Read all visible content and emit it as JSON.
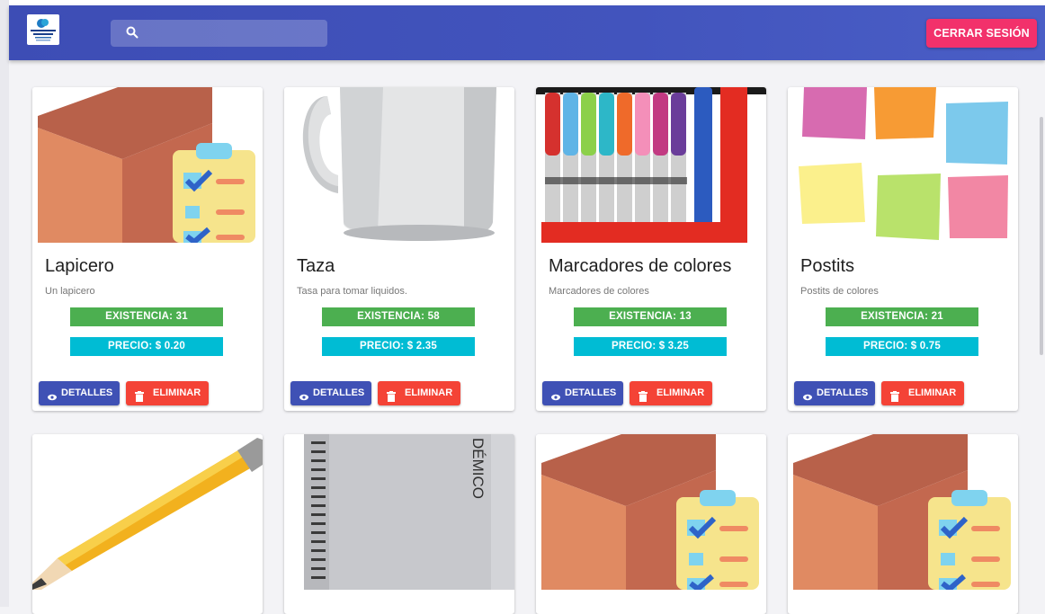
{
  "header": {
    "search_placeholder": "",
    "logout_label": "CERRAR SESIÓN"
  },
  "colors": {
    "appbar": "#3f51b5",
    "logout": "#f2316b",
    "stock_chip": "#4caf50",
    "price_chip": "#00bcd4",
    "details_button": "#3f51b5",
    "delete_button": "#f44336"
  },
  "icons": {
    "search": "search-icon",
    "details": "eye-icon",
    "delete": "trash-icon"
  },
  "products": [
    {
      "image": "box-checklist",
      "name": "Lapicero",
      "description": "Un lapicero",
      "stock": "EXISTENCIA: 31",
      "price": "PRECIO: $ 0.20",
      "details_label": "DETALLES",
      "delete_label": "ELIMINAR"
    },
    {
      "image": "mug",
      "name": "Taza",
      "description": "Tasa para tomar liquidos.",
      "stock": "EXISTENCIA: 58",
      "price": "PRECIO: $ 2.35",
      "details_label": "DETALLES",
      "delete_label": "ELIMINAR"
    },
    {
      "image": "markers",
      "name": "Marcadores de colores",
      "description": "Marcadores de colores",
      "stock": "EXISTENCIA: 13",
      "price": "PRECIO: $ 3.25",
      "details_label": "DETALLES",
      "delete_label": "ELIMINAR"
    },
    {
      "image": "sticky-notes",
      "name": "Postits",
      "description": "Postits de colores",
      "stock": "EXISTENCIA: 21",
      "price": "PRECIO: $ 0.75",
      "details_label": "DETALLES",
      "delete_label": "ELIMINAR"
    },
    {
      "image": "pencil"
    },
    {
      "image": "notebook",
      "notebook_brand": "DÉMICO"
    },
    {
      "image": "box-checklist"
    },
    {
      "image": "box-checklist"
    }
  ]
}
